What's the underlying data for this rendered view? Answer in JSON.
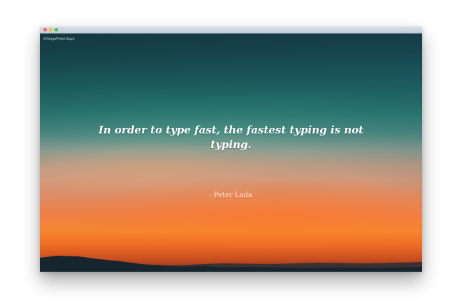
{
  "window": {
    "controls": {
      "close_icon": "close-icon",
      "minimize_icon": "minimize-icon",
      "maximize_icon": "maximize-icon",
      "close_color": "#fc605c",
      "minimize_color": "#fdbc40",
      "maximize_color": "#34c84a"
    }
  },
  "page": {
    "hashtag": "#thingsPeterSays",
    "quote": "In order to type fast, the fastest typing is not typing.",
    "author": "- Peter Lada"
  },
  "colors": {
    "sky_top": "#173f48",
    "sky_teal": "#2f7f76",
    "sky_orange": "#f5862e",
    "hill": "#16252e"
  }
}
